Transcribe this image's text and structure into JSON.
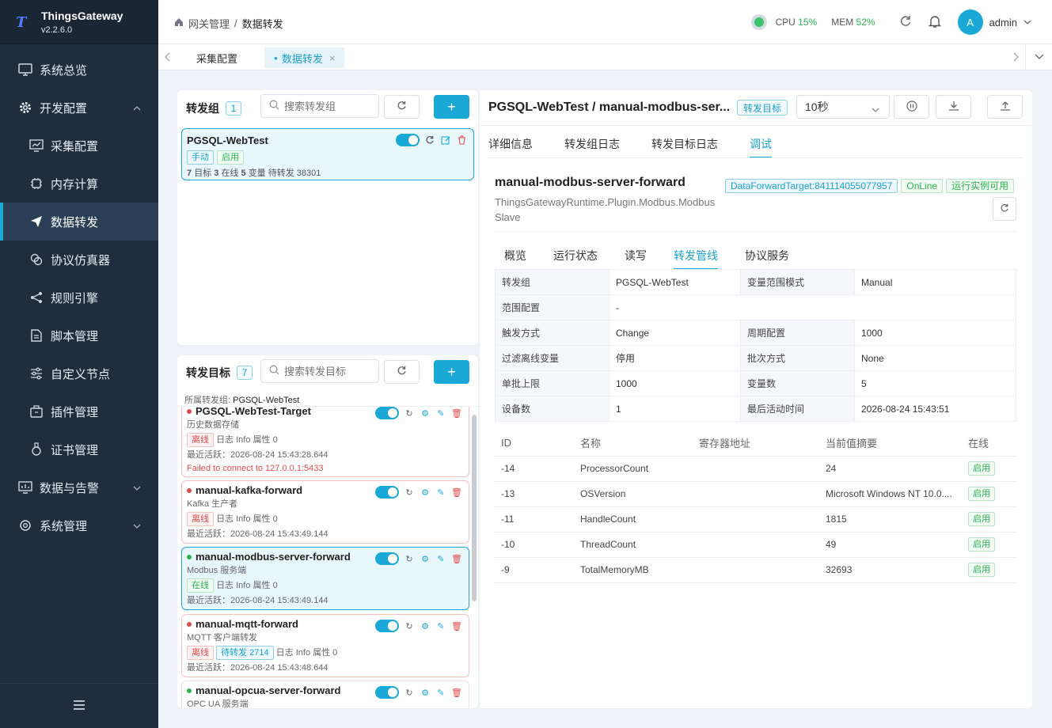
{
  "app": {
    "name": "ThingsGateway",
    "version": "v2.2.6.0"
  },
  "sidebar": {
    "items": [
      {
        "label": "系统总览"
      },
      {
        "label": "开发配置"
      },
      {
        "label": "采集配置"
      },
      {
        "label": "内存计算"
      },
      {
        "label": "数据转发"
      },
      {
        "label": "协议仿真器"
      },
      {
        "label": "规则引擎"
      },
      {
        "label": "脚本管理"
      },
      {
        "label": "自定义节点"
      },
      {
        "label": "插件管理"
      },
      {
        "label": "证书管理"
      },
      {
        "label": "数据与告警"
      },
      {
        "label": "系统管理"
      }
    ]
  },
  "header": {
    "breadcrumb": [
      "网关管理",
      "/",
      "数据转发"
    ],
    "cpu_label": "CPU",
    "cpu_value": "15%",
    "mem_label": "MEM",
    "mem_value": "52%",
    "avatar": "A",
    "user": "admin"
  },
  "tabs": [
    {
      "label": "采集配置"
    },
    {
      "label": "数据转发"
    }
  ],
  "groups": {
    "title": "转发组",
    "count": "1",
    "search_placeholder": "搜索转发组",
    "add": "+",
    "card": {
      "name": "PGSQL-WebTest",
      "tag1": "手动",
      "tag2": "启用",
      "n1": "7",
      "l1": "目标",
      "n2": "3",
      "l2": "在线",
      "n3": "5",
      "l3": "变量",
      "pending": "待转发 38301"
    }
  },
  "targets": {
    "title": "转发目标",
    "count": "7",
    "search_placeholder": "搜索转发目标",
    "add": "+",
    "owner_label": "所属转发组:",
    "owner_value": "PGSQL-WebTest",
    "items": [
      {
        "name": "PGSQL-WebTest-Target",
        "desc": "历史数据存储",
        "status": "离线",
        "info": "日志 Info 属性 0",
        "last": "最近活跃：2026-08-24 15:43:28.644",
        "error": "Failed to connect to 127.0.0.1:5433"
      },
      {
        "name": "manual-kafka-forward",
        "desc": "Kafka 生产者",
        "status": "离线",
        "info": "日志 Info 属性 0",
        "last": "最近活跃：2026-08-24 15:43:49.144"
      },
      {
        "name": "manual-modbus-server-forward",
        "desc": "Modbus 服务端",
        "status": "在线",
        "info": "日志 Info 属性 0",
        "last": "最近活跃：2026-08-24 15:43:49.144"
      },
      {
        "name": "manual-mqtt-forward",
        "desc": "MQTT 客户端转发",
        "status": "离线",
        "pending": "待转发 2714",
        "info": "日志 Info 属性 0",
        "last": "最近活跃：2026-08-24 15:43:48.644"
      },
      {
        "name": "manual-opcua-server-forward",
        "desc": "OPC UA 服务端"
      }
    ]
  },
  "detail": {
    "title": "PGSQL-WebTest / manual-modbus-ser...",
    "title_badge": "转发目标",
    "interval": "10秒",
    "tabs": [
      "详细信息",
      "转发组日志",
      "转发目标日志",
      "调试"
    ],
    "name": "manual-modbus-server-forward",
    "plugin": "ThingsGatewayRuntime.Plugin.Modbus.ModbusSlave",
    "id_tag": "DataForwardTarget:841114055077957",
    "online_tag": "OnLine",
    "avail_tag": "运行实例可用",
    "subtabs": [
      "概览",
      "运行状态",
      "读写",
      "转发管线",
      "协议服务"
    ],
    "kv": [
      [
        "转发组",
        "PGSQL-WebTest",
        "变量范围模式",
        "Manual"
      ],
      [
        "范围配置",
        "-"
      ],
      [
        "触发方式",
        "Change",
        "周期配置",
        "1000"
      ],
      [
        "过滤离线变量",
        "停用",
        "批次方式",
        "None"
      ],
      [
        "单批上限",
        "1000",
        "变量数",
        "5"
      ],
      [
        "设备数",
        "1",
        "最后活动时间",
        "2026-08-24 15:43:51"
      ]
    ],
    "columns": [
      "ID",
      "名称",
      "寄存器地址",
      "当前值摘要",
      "在线"
    ],
    "rows": [
      [
        "-14",
        "ProcessorCount",
        "",
        "24",
        "启用"
      ],
      [
        "-13",
        "OSVersion",
        "",
        "Microsoft Windows NT 10.0....",
        "启用"
      ],
      [
        "-11",
        "HandleCount",
        "",
        "1815",
        "启用"
      ],
      [
        "-10",
        "ThreadCount",
        "",
        "49",
        "启用"
      ],
      [
        "-9",
        "TotalMemoryMB",
        "",
        "32693",
        "启用"
      ]
    ]
  },
  "colors": {
    "accent": "#1aa8d6",
    "sidebar": "#1f2d3d",
    "online": "#2bb34f",
    "offline": "#e24b4b"
  }
}
